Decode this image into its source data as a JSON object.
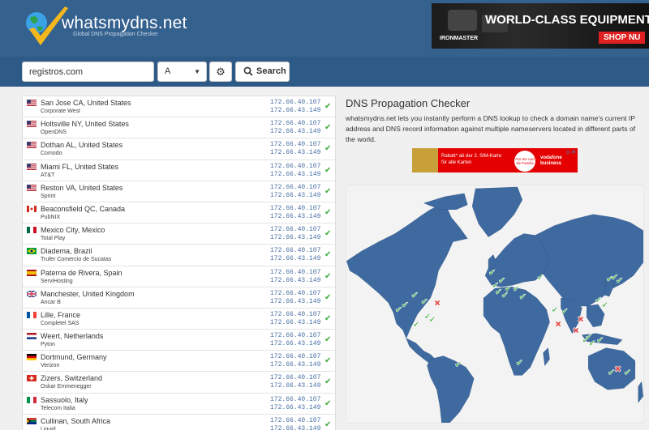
{
  "header": {
    "brand": "whatsmydns.net",
    "tagline": "Global DNS Propagation Checker",
    "ad": {
      "headline": "WORLD-CLASS EQUIPMENT F",
      "cta": "SHOP NU",
      "brand": "IRONMASTER"
    }
  },
  "search": {
    "domain_value": "registros.com",
    "record_type": "A",
    "search_label": "Search"
  },
  "colors": {
    "header": "#35618f",
    "searchbar": "#2e5a88",
    "ok": "#3cab3c",
    "fail": "#e24545",
    "land": "#3e6aa0",
    "ip": "#4a6fa6"
  },
  "icons": {
    "settings": "gear-icon",
    "search": "magnifier-icon",
    "status": "check-icon"
  },
  "results": [
    {
      "location": "San Jose CA, United States",
      "provider": "Corporate West",
      "flag": "us",
      "ips": [
        "172.66.40.107",
        "172.66.43.149"
      ]
    },
    {
      "location": "Holtsville NY, United States",
      "provider": "OpenDNS",
      "flag": "us",
      "ips": [
        "172.66.40.107",
        "172.66.43.149"
      ]
    },
    {
      "location": "Dothan AL, United States",
      "provider": "Comodo",
      "flag": "us",
      "ips": [
        "172.66.40.107",
        "172.66.43.149"
      ]
    },
    {
      "location": "Miami FL, United States",
      "provider": "AT&T",
      "flag": "us",
      "ips": [
        "172.66.40.107",
        "172.66.43.149"
      ]
    },
    {
      "location": "Reston VA, United States",
      "provider": "Sprint",
      "flag": "us",
      "ips": [
        "172.66.40.107",
        "172.66.43.149"
      ]
    },
    {
      "location": "Beaconsfield QC, Canada",
      "provider": "PubNIX",
      "flag": "ca",
      "ips": [
        "172.66.40.107",
        "172.66.43.149"
      ]
    },
    {
      "location": "Mexico City, Mexico",
      "provider": "Total Play",
      "flag": "mx",
      "ips": [
        "172.66.40.107",
        "172.66.43.149"
      ]
    },
    {
      "location": "Diadema, Brazil",
      "provider": "Trufer Comercio de Sucatas",
      "flag": "br",
      "ips": [
        "172.66.40.107",
        "172.66.43.149"
      ]
    },
    {
      "location": "Paterna de Rivera, Spain",
      "provider": "ServiHosting",
      "flag": "es",
      "ips": [
        "172.66.40.107",
        "172.66.43.149"
      ]
    },
    {
      "location": "Manchester, United Kingdom",
      "provider": "Ancar B",
      "flag": "gb",
      "ips": [
        "172.66.40.107",
        "172.66.43.149"
      ]
    },
    {
      "location": "Lille, France",
      "provider": "Completel SAS",
      "flag": "fr",
      "ips": [
        "172.66.40.107",
        "172.66.43.149"
      ]
    },
    {
      "location": "Weert, Netherlands",
      "provider": "Pyton",
      "flag": "nl",
      "ips": [
        "172.66.40.107",
        "172.66.43.149"
      ]
    },
    {
      "location": "Dortmund, Germany",
      "provider": "Verizon",
      "flag": "de",
      "ips": [
        "172.66.40.107",
        "172.66.43.149"
      ]
    },
    {
      "location": "Zizers, Switzerland",
      "provider": "Oskar Emmenegger",
      "flag": "ch",
      "ips": [
        "172.66.40.107",
        "172.66.43.149"
      ]
    },
    {
      "location": "Sassuolo, Italy",
      "provider": "Telecom Italia",
      "flag": "it",
      "ips": [
        "172.66.40.107",
        "172.66.43.149"
      ]
    },
    {
      "location": "Cullinan, South Africa",
      "provider": "Liquid",
      "flag": "za",
      "ips": [
        "172.66.40.107",
        "172.66.43.149"
      ]
    }
  ],
  "info": {
    "title": "DNS Propagation Checker",
    "body": "whatsmydns.net lets you instantly perform a DNS lookup to check a domain name's current IP address and DNS record information against multiple nameservers located in different parts of the world."
  },
  "mini_ad": {
    "text_line1": "Rabatt* ab der 2. SIM-Karte",
    "text_line2": "für alle Karten",
    "badge": "Für Sie und die Familie",
    "brand_line1": "vodafone",
    "brand_line2": "business"
  }
}
